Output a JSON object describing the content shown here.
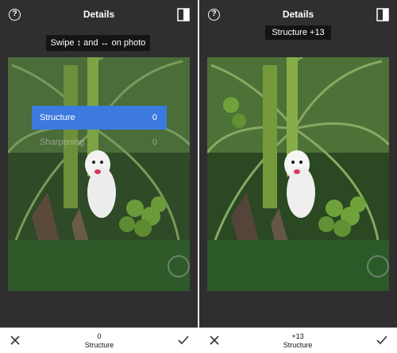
{
  "left": {
    "title": "Details",
    "hint": "Swipe ↕ and ↔ on photo",
    "menu": [
      {
        "label": "Structure",
        "value": "0"
      },
      {
        "label": "Sharpening",
        "value": "0"
      }
    ],
    "bottom_value": "0",
    "bottom_label": "Structure"
  },
  "right": {
    "title": "Details",
    "pill_label": "Structure",
    "pill_value": "+13",
    "bottom_value": "+13",
    "bottom_label": "Structure"
  },
  "icons": [
    "help-icon",
    "compare-icon",
    "close-icon",
    "check-icon"
  ],
  "colors": {
    "accent": "#3c7ae0",
    "panel": "#2f2f2f",
    "toolbar": "#ffffff"
  }
}
